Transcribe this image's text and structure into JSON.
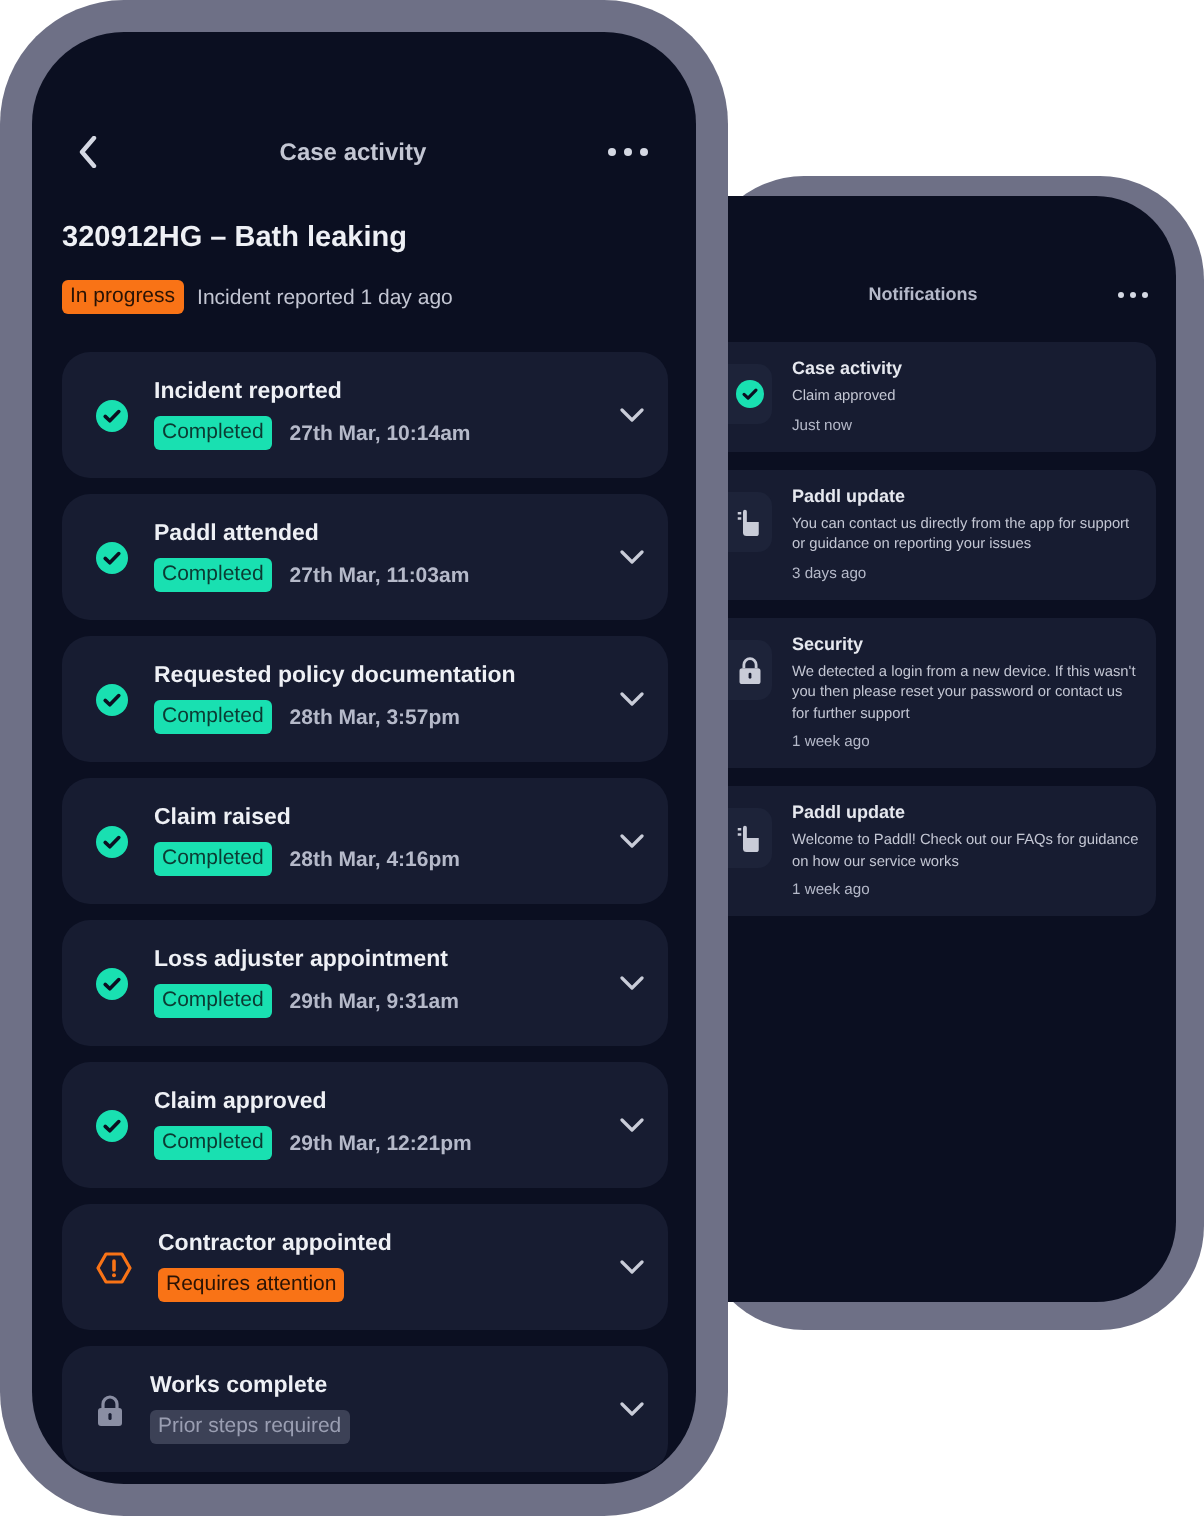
{
  "case_screen": {
    "title": "Case activity",
    "case_title": "320912HG – Bath leaking",
    "status": {
      "label": "In progress",
      "kind": "progress"
    },
    "status_note": "Incident reported 1 day ago",
    "steps": [
      {
        "title": "Incident reported",
        "kind": "completed",
        "badge": "Completed",
        "date": "27th Mar, 10:14am"
      },
      {
        "title": "Paddl attended",
        "kind": "completed",
        "badge": "Completed",
        "date": "27th Mar, 11:03am"
      },
      {
        "title": "Requested policy documentation",
        "kind": "completed",
        "badge": "Completed",
        "date": "28th Mar, 3:57pm"
      },
      {
        "title": "Claim raised",
        "kind": "completed",
        "badge": "Completed",
        "date": "28th Mar, 4:16pm"
      },
      {
        "title": "Loss adjuster appointment",
        "kind": "completed",
        "badge": "Completed",
        "date": "29th Mar, 9:31am"
      },
      {
        "title": "Claim approved",
        "kind": "completed",
        "badge": "Completed",
        "date": "29th Mar, 12:21pm"
      },
      {
        "title": "Contractor appointed",
        "kind": "attention",
        "badge": "Requires attention"
      },
      {
        "title": "Works complete",
        "kind": "locked",
        "badge": "Prior steps required"
      }
    ]
  },
  "notifications_screen": {
    "title": "Notifications",
    "items": [
      {
        "kind": "check",
        "title": "Case activity",
        "body": "Claim approved",
        "time": "Just now"
      },
      {
        "kind": "hand",
        "title": "Paddl update",
        "body": "You can contact us directly from the app for support or guidance on reporting your issues",
        "time": "3 days ago"
      },
      {
        "kind": "lock",
        "title": "Security",
        "body": "We detected a login from a new device. If this wasn't you then please reset your password or contact us for further support",
        "time": "1 week ago"
      },
      {
        "kind": "hand",
        "title": "Paddl update",
        "body": "Welcome to Paddl! Check out our FAQs for guidance on how our service works",
        "time": "1 week ago"
      }
    ]
  }
}
